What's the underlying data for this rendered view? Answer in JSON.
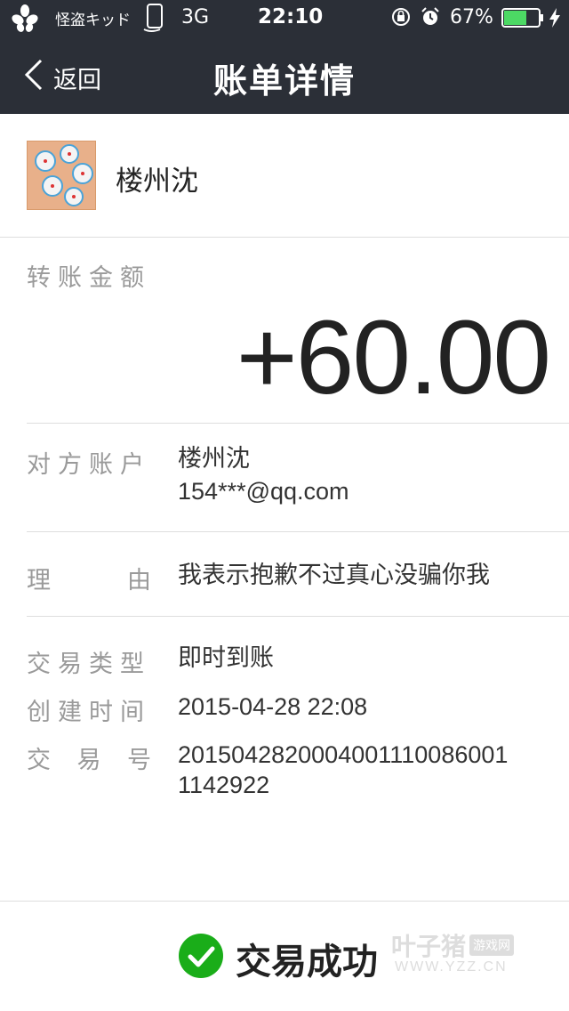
{
  "status_bar": {
    "carrier": "怪盗キッド",
    "network": "3G",
    "time": "22:10",
    "battery_percent": "67%",
    "battery_level": 0.67,
    "icons": [
      "flower-icon",
      "sim-icon",
      "rotation-lock-icon",
      "alarm-icon",
      "battery-icon",
      "charging-icon"
    ]
  },
  "nav": {
    "back_label": "返回",
    "title": "账单详情"
  },
  "contact": {
    "name": "楼州沈"
  },
  "amount": {
    "label": "转账金额",
    "value": "+60.00"
  },
  "details": {
    "counterparty": {
      "label": "对方账户",
      "name": "楼州沈",
      "account": "154***@qq.com"
    },
    "reason": {
      "label_left": "理",
      "label_right": "由",
      "value": "我表示抱歉不过真心没骗你我"
    },
    "type": {
      "label": "交易类型",
      "value": "即时到账"
    },
    "created": {
      "label": "创建时间",
      "value": "2015-04-28 22:08"
    },
    "trade_no": {
      "label_a": "交",
      "label_b": "易",
      "label_c": "号",
      "value_line1": "2015042820004001110086001",
      "value_line2": "1142922"
    }
  },
  "footer": {
    "status": "交易成功",
    "watermark_main": "叶子猪",
    "watermark_tag": "游戏网",
    "watermark_url": "WWW.YZZ.CN"
  },
  "colors": {
    "header_bg": "#2b2f37",
    "success_green": "#1aad19",
    "label_gray": "#9a9a9a"
  }
}
